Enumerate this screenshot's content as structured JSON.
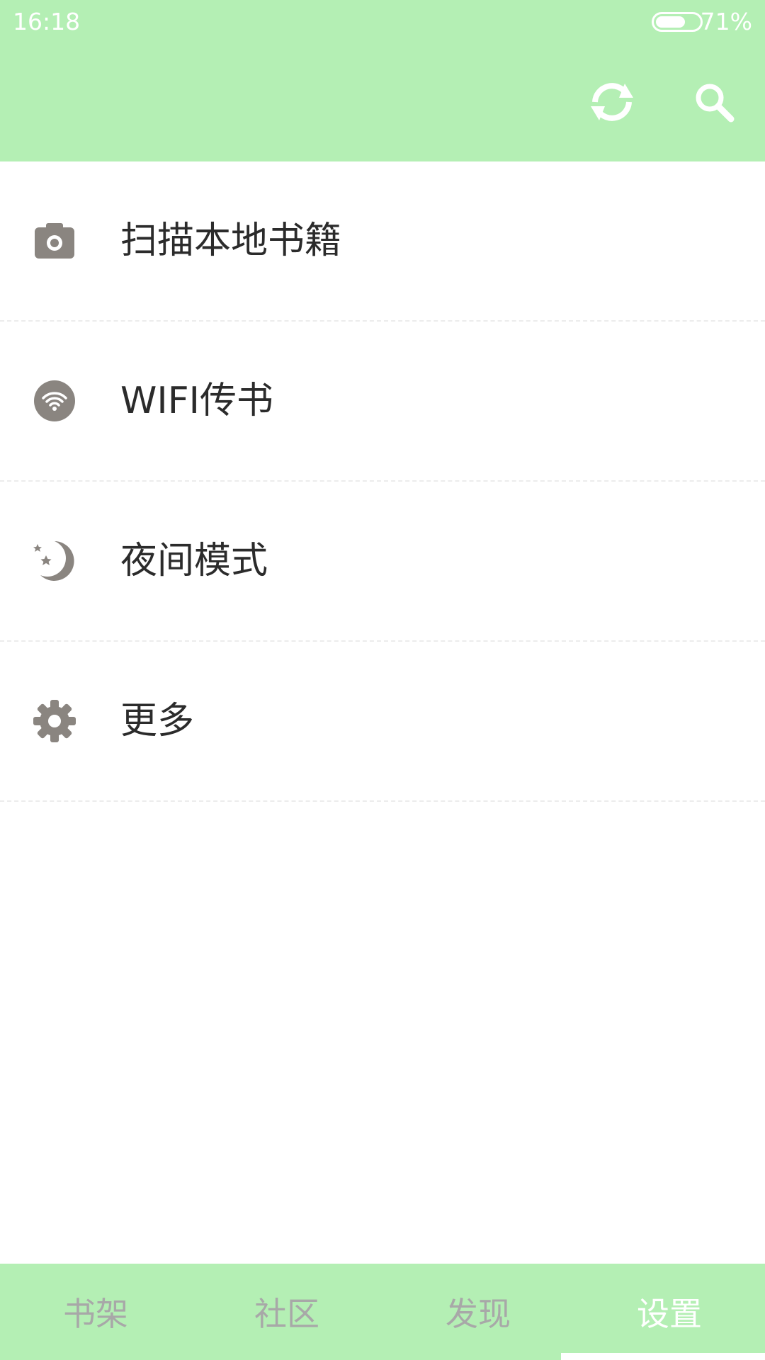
{
  "status_bar": {
    "time": "16:18",
    "battery_percent_text": "71%",
    "battery_level": 0.71
  },
  "toolbar": {
    "refresh_icon": "refresh-icon",
    "search_icon": "search-icon"
  },
  "menu": {
    "items": [
      {
        "label": "扫描本地书籍",
        "icon": "camera-icon"
      },
      {
        "label": "WIFI传书",
        "icon": "wifi-icon"
      },
      {
        "label": "夜间模式",
        "icon": "moon-stars-icon"
      },
      {
        "label": "更多",
        "icon": "gear-icon"
      }
    ]
  },
  "bottom_nav": {
    "tabs": [
      {
        "label": "书架",
        "active": false
      },
      {
        "label": "社区",
        "active": false
      },
      {
        "label": "发现",
        "active": false
      },
      {
        "label": "设置",
        "active": true
      }
    ]
  },
  "colors": {
    "header_bg": "#b4efb4",
    "icon_gray": "#8a8580",
    "text_dark": "#2b2b2b",
    "tab_inactive": "#a8a8a8",
    "tab_active": "#ffffff"
  }
}
